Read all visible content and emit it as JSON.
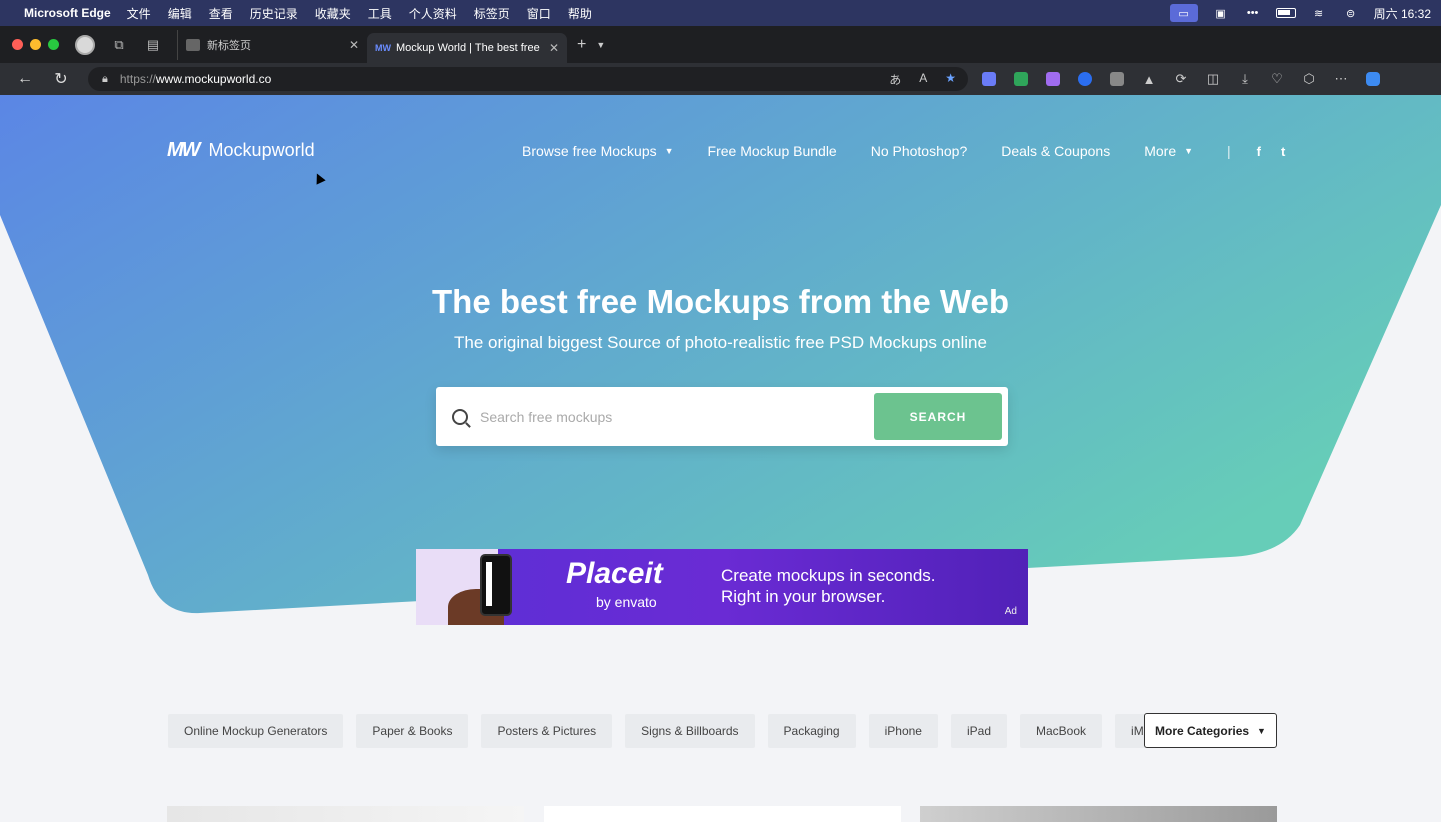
{
  "menubar": {
    "app_name": "Microsoft Edge",
    "items": [
      "文件",
      "编辑",
      "查看",
      "历史记录",
      "收藏夹",
      "工具",
      "个人资料",
      "标签页",
      "窗口",
      "帮助"
    ],
    "clock": "周六 16:32"
  },
  "tabs": {
    "inactive_title": "新标签页",
    "active_title": "Mockup World | The best free M"
  },
  "address": {
    "prefix": "https://",
    "host": "www.mockupworld.co"
  },
  "site": {
    "logo_text": "Mockupworld",
    "logo_mark": "MW",
    "nav": {
      "browse": "Browse free Mockups",
      "bundle": "Free Mockup Bundle",
      "no_ps": "No Photoshop?",
      "deals": "Deals & Coupons",
      "more": "More",
      "divider": "|",
      "facebook": "f",
      "twitter": "t"
    },
    "hero_title": "The best free Mockups from the Web",
    "hero_subtitle": "The original biggest Source of photo-realistic free PSD Mockups online",
    "search": {
      "placeholder": "Search free mockups",
      "button": "SEARCH"
    },
    "ad": {
      "brand": "Placeit",
      "by": "by envato",
      "line1": "Create mockups in seconds.",
      "line2": "Right in your browser.",
      "label": "Ad"
    },
    "categories": [
      "Online Mockup Generators",
      "Paper & Books",
      "Posters & Pictures",
      "Signs & Billboards",
      "Packaging",
      "iPhone",
      "iPad",
      "MacBook",
      "iMac"
    ],
    "more_categories": "More Categories"
  },
  "colors": {
    "hero_start": "#5b86e5",
    "hero_end": "#66cdb8",
    "search_button": "#6cc38f",
    "ad_purple": "#5b2fd6"
  }
}
